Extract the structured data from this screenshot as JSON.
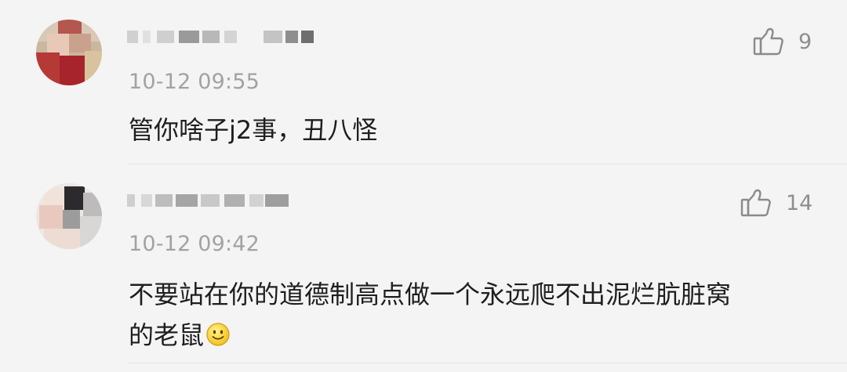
{
  "comments": [
    {
      "username": "",
      "time": "10-12 09:55",
      "text": "管你啥子j2事，丑八怪",
      "likes": "9",
      "avatar_icon": "pixelated-avatar",
      "like_icon": "thumbs-up-icon"
    },
    {
      "username": "",
      "time": "10-12 09:42",
      "text_line1": "不要站在你的道德制高点做一个永远爬不出泥烂肮脏窝",
      "text_line2": "的老鼠",
      "emoji": "smiley-emoji",
      "likes": "14",
      "avatar_icon": "pixelated-avatar",
      "like_icon": "thumbs-up-icon"
    }
  ],
  "colors": {
    "background": "#f4f4f4",
    "timestamp": "#a2a2a2",
    "like_count": "#8e8e8e",
    "text": "#1e1e1e",
    "divider": "#e2e2e2"
  }
}
